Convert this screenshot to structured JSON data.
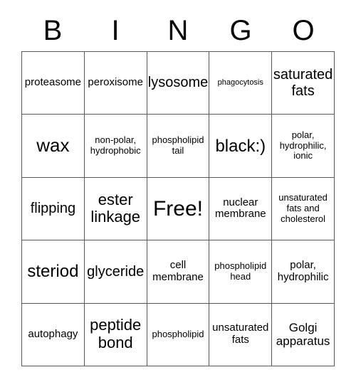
{
  "card": {
    "title_letters": [
      "B",
      "I",
      "N",
      "G",
      "O"
    ],
    "grid": {
      "columns": 5,
      "rows": 5,
      "cells": [
        {
          "text": "proteasome",
          "size": "fs-md"
        },
        {
          "text": "peroxisome",
          "size": "fs-md"
        },
        {
          "text": "lysosome",
          "size": "fs-xl"
        },
        {
          "text": "phagocytosis",
          "size": "fs-xs"
        },
        {
          "text": "saturated fats",
          "size": "fs-xl"
        },
        {
          "text": "wax",
          "size": "fs-4xl"
        },
        {
          "text": "non-polar, hydrophobic",
          "size": "fs-sm"
        },
        {
          "text": "phospholipid tail",
          "size": "fs-sm"
        },
        {
          "text": "black:)",
          "size": "fs-3xl"
        },
        {
          "text": "polar, hydrophilic, ionic",
          "size": "fs-sm"
        },
        {
          "text": "flipping",
          "size": "fs-xl"
        },
        {
          "text": "ester linkage",
          "size": "fs-2xl"
        },
        {
          "text": "Free!",
          "size": "fs-5xl"
        },
        {
          "text": "nuclear membrane",
          "size": "fs-md"
        },
        {
          "text": "unsaturated fats and cholesterol",
          "size": "fs-sm"
        },
        {
          "text": "steriod",
          "size": "fs-3xl"
        },
        {
          "text": "glyceride",
          "size": "fs-xl"
        },
        {
          "text": "cell membrane",
          "size": "fs-md"
        },
        {
          "text": "phospholipid head",
          "size": "fs-sm"
        },
        {
          "text": "polar, hydrophilic",
          "size": "fs-md"
        },
        {
          "text": "autophagy",
          "size": "fs-md"
        },
        {
          "text": "peptide bond",
          "size": "fs-2xl"
        },
        {
          "text": "phospholipid",
          "size": "fs-sm"
        },
        {
          "text": "unsaturated fats",
          "size": "fs-md"
        },
        {
          "text": "Golgi apparatus",
          "size": "fs-lg"
        }
      ]
    },
    "colors": {
      "background": "#ffffff",
      "text": "#000000",
      "grid_line": "#555a5e"
    }
  }
}
